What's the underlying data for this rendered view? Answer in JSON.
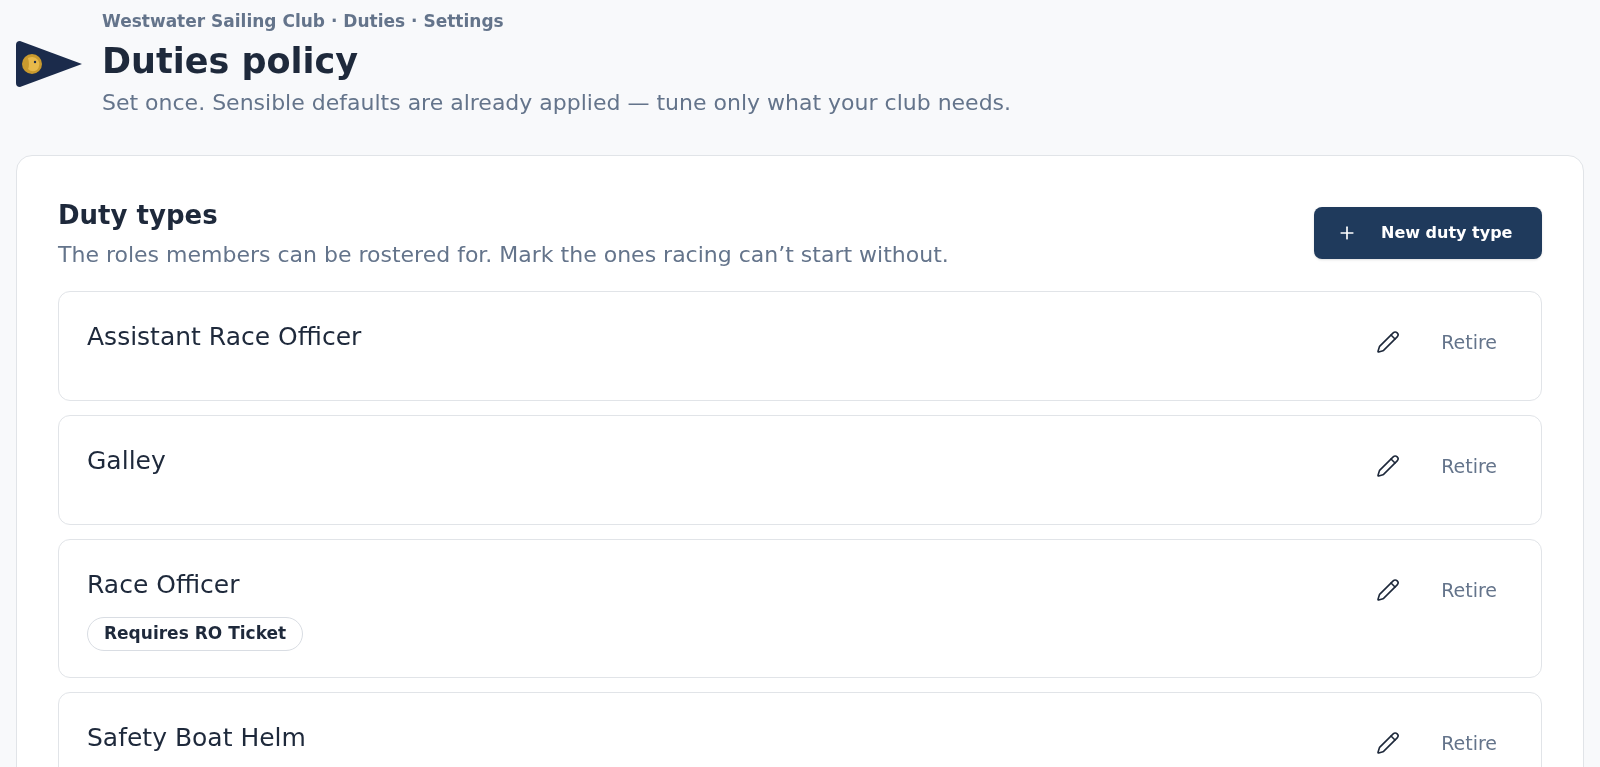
{
  "header": {
    "breadcrumb": "Westwater Sailing Club · Duties · Settings",
    "title": "Duties policy",
    "subtitle": "Set once. Sensible defaults are already applied — tune only what your club needs."
  },
  "duty_types": {
    "title": "Duty types",
    "description": "The roles members can be rostered for. Mark the ones racing can’t start without.",
    "new_button": {
      "label": "New duty type"
    },
    "rows": [
      {
        "name": "Assistant Race Officer",
        "action": "Retire"
      },
      {
        "name": "Galley",
        "action": "Retire"
      },
      {
        "name": "Race Officer",
        "requirement": "Requires RO Ticket",
        "action": "Retire"
      },
      {
        "name": "Safety Boat Helm",
        "action": "Retire"
      }
    ]
  }
}
